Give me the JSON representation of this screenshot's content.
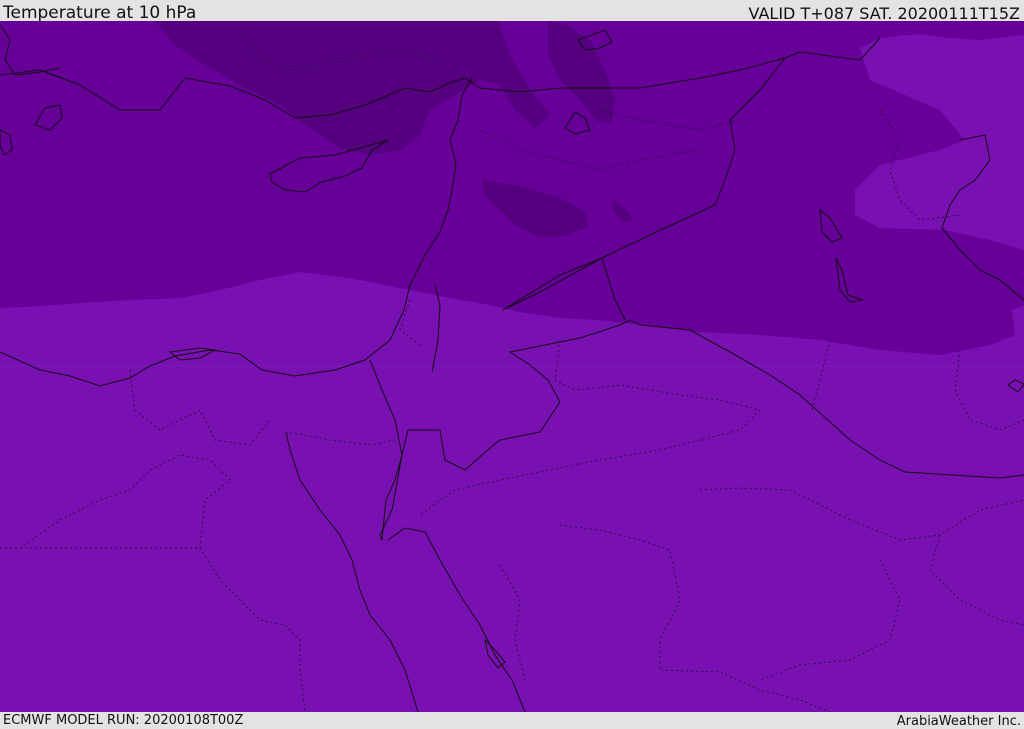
{
  "header": {
    "title": "Temperature at 10 hPa",
    "valid_time": "VALID T+087 SAT. 20200111T15Z"
  },
  "footer": {
    "model_run": "ECMWF MODEL RUN: 20200108T00Z",
    "credit": "ArabiaWeather Inc."
  },
  "map": {
    "colors": {
      "band_warm": "#7810b2",
      "band_mid": "#660099",
      "band_cool": "#55007f",
      "border_line": "#111111",
      "province_line": "#2a1040"
    }
  }
}
